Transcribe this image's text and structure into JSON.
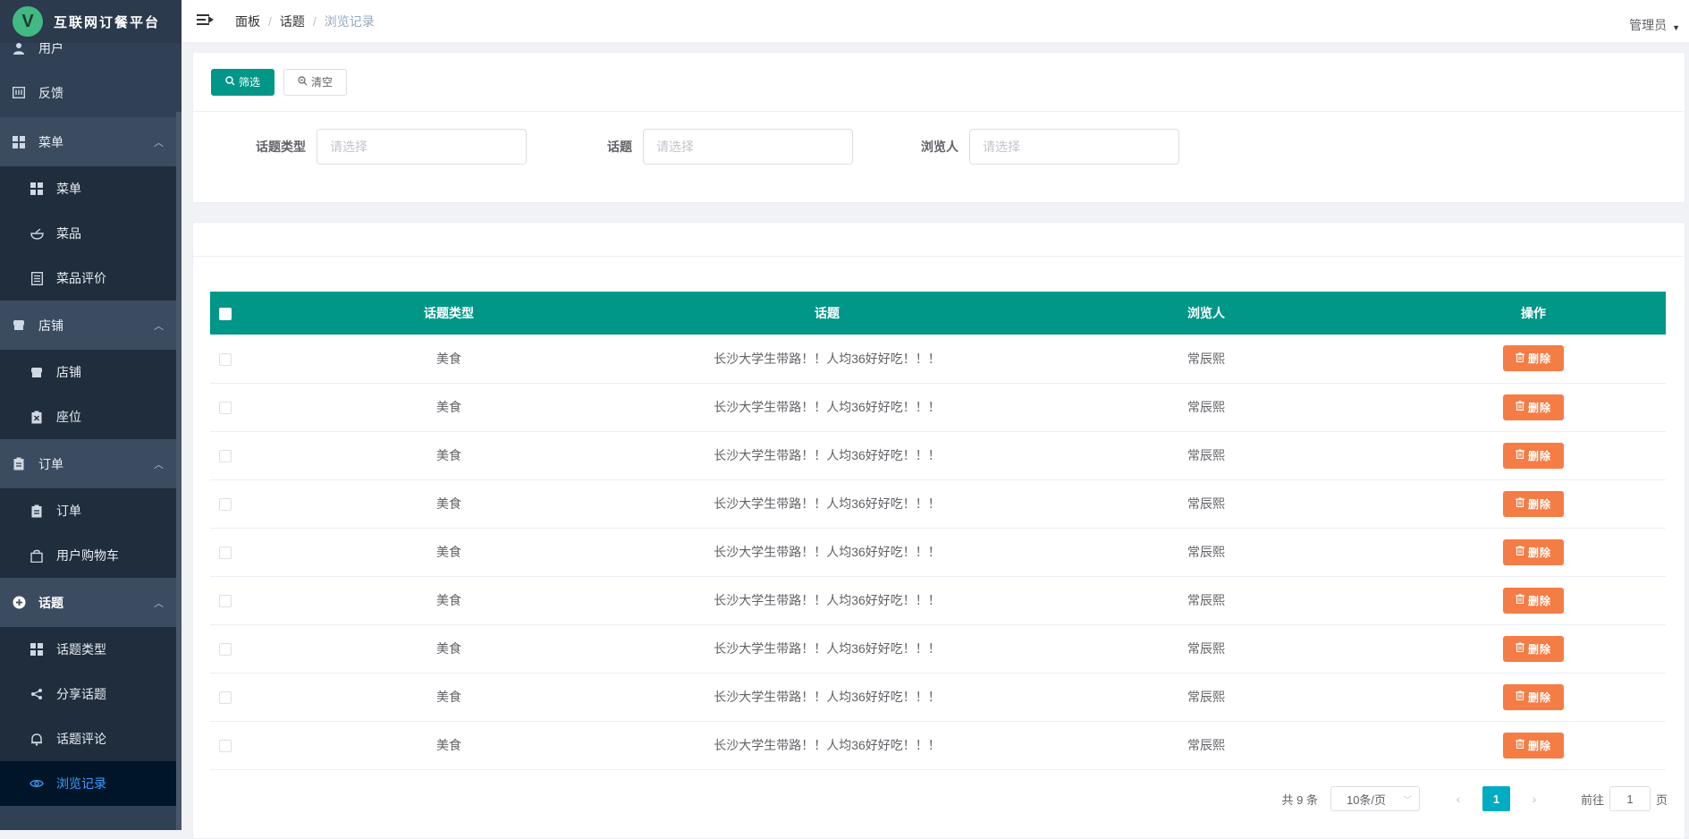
{
  "app": {
    "logo_letter": "V",
    "title": "互联网订餐平台"
  },
  "sidebar": {
    "items": [
      {
        "label": "用户",
        "icon": "user-icon",
        "type": "top"
      },
      {
        "label": "反馈",
        "icon": "feedback-icon",
        "type": "top"
      },
      {
        "label": "菜单",
        "icon": "grid-icon",
        "type": "parent"
      },
      {
        "label": "菜单",
        "icon": "grid-icon",
        "type": "sub"
      },
      {
        "label": "菜品",
        "icon": "bowl-icon",
        "type": "sub"
      },
      {
        "label": "菜品评价",
        "icon": "document-icon",
        "type": "sub"
      },
      {
        "label": "店铺",
        "icon": "shop-icon",
        "type": "parent"
      },
      {
        "label": "店铺",
        "icon": "shop-icon",
        "type": "sub"
      },
      {
        "label": "座位",
        "icon": "seat-icon",
        "type": "sub"
      },
      {
        "label": "订单",
        "icon": "clipboard-icon",
        "type": "parent"
      },
      {
        "label": "订单",
        "icon": "clipboard-icon",
        "type": "sub"
      },
      {
        "label": "用户购物车",
        "icon": "bag-icon",
        "type": "sub"
      },
      {
        "label": "话题",
        "icon": "plus-circle-icon",
        "type": "parent"
      },
      {
        "label": "话题类型",
        "icon": "grid-icon",
        "type": "sub"
      },
      {
        "label": "分享话题",
        "icon": "share-icon",
        "type": "sub"
      },
      {
        "label": "话题评论",
        "icon": "bell-icon",
        "type": "sub"
      },
      {
        "label": "浏览记录",
        "icon": "eye-icon",
        "type": "sub",
        "active": true
      }
    ]
  },
  "navbar": {
    "breadcrumb": [
      "面板",
      "话题",
      "浏览记录"
    ],
    "user": "管理员"
  },
  "filter": {
    "filter_button": "筛选",
    "clear_button": "清空",
    "fields": [
      {
        "label": "话题类型",
        "placeholder": "请选择"
      },
      {
        "label": "话题",
        "placeholder": "请选择"
      },
      {
        "label": "浏览人",
        "placeholder": "请选择"
      }
    ]
  },
  "table": {
    "columns": [
      "话题类型",
      "话题",
      "浏览人",
      "操作"
    ],
    "delete_label": "删除",
    "rows": [
      {
        "type": "美食",
        "topic": "长沙大学生带路！！人均36好好吃！！！",
        "viewer": "常辰熙"
      },
      {
        "type": "美食",
        "topic": "长沙大学生带路！！人均36好好吃！！！",
        "viewer": "常辰熙"
      },
      {
        "type": "美食",
        "topic": "长沙大学生带路！！人均36好好吃！！！",
        "viewer": "常辰熙"
      },
      {
        "type": "美食",
        "topic": "长沙大学生带路！！人均36好好吃！！！",
        "viewer": "常辰熙"
      },
      {
        "type": "美食",
        "topic": "长沙大学生带路！！人均36好好吃！！！",
        "viewer": "常辰熙"
      },
      {
        "type": "美食",
        "topic": "长沙大学生带路！！人均36好好吃！！！",
        "viewer": "常辰熙"
      },
      {
        "type": "美食",
        "topic": "长沙大学生带路！！人均36好好吃！！！",
        "viewer": "常辰熙"
      },
      {
        "type": "美食",
        "topic": "长沙大学生带路！！人均36好好吃！！！",
        "viewer": "常辰熙"
      },
      {
        "type": "美食",
        "topic": "长沙大学生带路！！人均36好好吃！！！",
        "viewer": "常辰熙"
      }
    ]
  },
  "pagination": {
    "total": "共 9 条",
    "page_size": "10条/页",
    "current_page": "1",
    "goto_prefix": "前往",
    "goto_value": "1",
    "goto_suffix": "页"
  },
  "colors": {
    "sidebar_bg": "#304156",
    "primary": "#009688",
    "delete": "#f57c45",
    "active_page": "#00acc1",
    "active_menu": "#409eff"
  }
}
